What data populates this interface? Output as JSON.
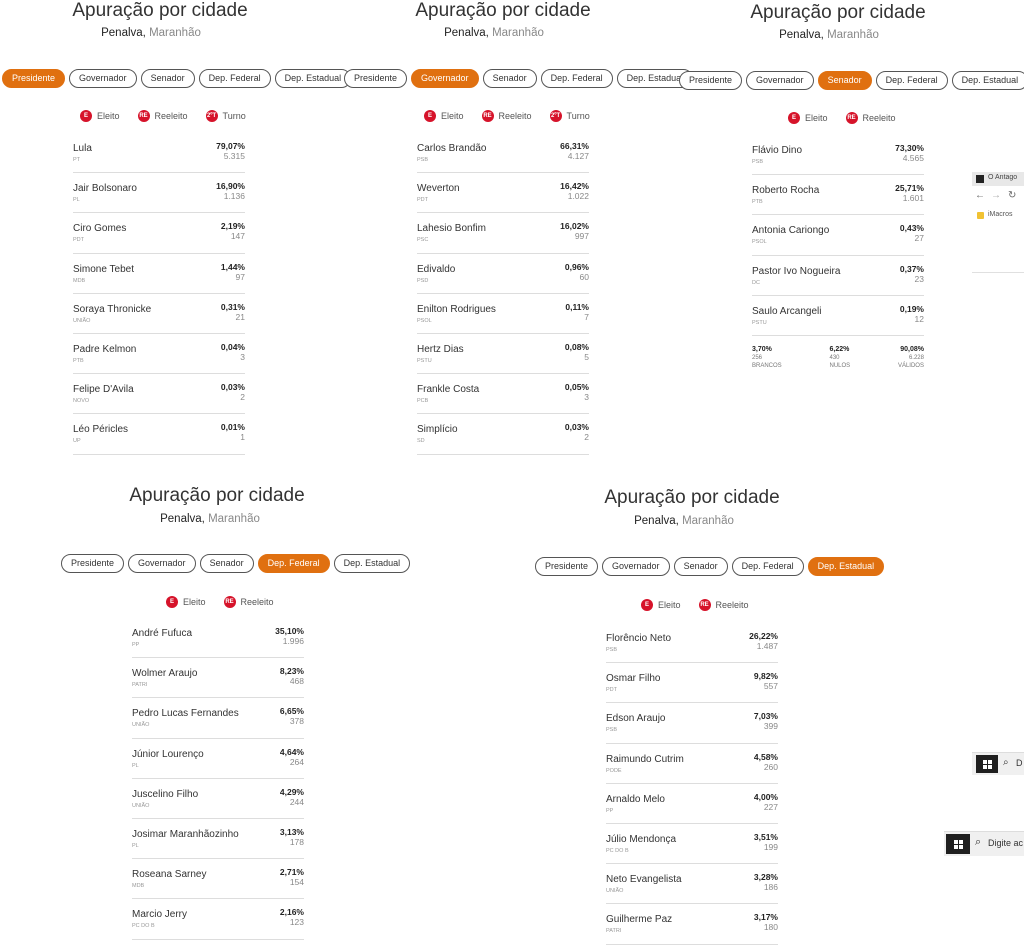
{
  "header": {
    "title": "Apuração por cidade",
    "city": "Penalva,",
    "state": "Maranhão"
  },
  "tabs": [
    "Presidente",
    "Governador",
    "Senador",
    "Dep. Federal",
    "Dep. Estadual"
  ],
  "legend": {
    "elected_badge": "E",
    "elected_label": "Eleito",
    "reelected_badge": "RE",
    "reelected_label": "Reeleito",
    "runoff_badge": "2ºT",
    "runoff_label": "Turno"
  },
  "panels": {
    "presidente": [
      {
        "name": "Lula",
        "party": "PT",
        "pct": "79,07%",
        "votes": "5.315"
      },
      {
        "name": "Jair Bolsonaro",
        "party": "PL",
        "pct": "16,90%",
        "votes": "1.136"
      },
      {
        "name": "Ciro Gomes",
        "party": "PDT",
        "pct": "2,19%",
        "votes": "147"
      },
      {
        "name": "Simone Tebet",
        "party": "MDB",
        "pct": "1,44%",
        "votes": "97"
      },
      {
        "name": "Soraya Thronicke",
        "party": "UNIÃO",
        "pct": "0,31%",
        "votes": "21"
      },
      {
        "name": "Padre Kelmon",
        "party": "PTB",
        "pct": "0,04%",
        "votes": "3"
      },
      {
        "name": "Felipe D'Avila",
        "party": "NOVO",
        "pct": "0,03%",
        "votes": "2"
      },
      {
        "name": "Léo Péricles",
        "party": "UP",
        "pct": "0,01%",
        "votes": "1"
      }
    ],
    "governador": [
      {
        "name": "Carlos Brandão",
        "party": "PSB",
        "pct": "66,31%",
        "votes": "4.127"
      },
      {
        "name": "Weverton",
        "party": "PDT",
        "pct": "16,42%",
        "votes": "1.022"
      },
      {
        "name": "Lahesio Bonfim",
        "party": "PSC",
        "pct": "16,02%",
        "votes": "997"
      },
      {
        "name": "Edivaldo",
        "party": "PSD",
        "pct": "0,96%",
        "votes": "60"
      },
      {
        "name": "Enilton Rodrigues",
        "party": "PSOL",
        "pct": "0,11%",
        "votes": "7"
      },
      {
        "name": "Hertz Dias",
        "party": "PSTU",
        "pct": "0,08%",
        "votes": "5"
      },
      {
        "name": "Frankle Costa",
        "party": "PCB",
        "pct": "0,05%",
        "votes": "3"
      },
      {
        "name": "Simplício",
        "party": "SD",
        "pct": "0,03%",
        "votes": "2"
      }
    ],
    "senador": [
      {
        "name": "Flávio Dino",
        "party": "PSB",
        "pct": "73,30%",
        "votes": "4.565"
      },
      {
        "name": "Roberto Rocha",
        "party": "PTB",
        "pct": "25,71%",
        "votes": "1.601"
      },
      {
        "name": "Antonia Cariongo",
        "party": "PSOL",
        "pct": "0,43%",
        "votes": "27"
      },
      {
        "name": "Pastor Ivo Nogueira",
        "party": "DC",
        "pct": "0,37%",
        "votes": "23"
      },
      {
        "name": "Saulo Arcangeli",
        "party": "PSTU",
        "pct": "0,19%",
        "votes": "12"
      }
    ],
    "senador_totals": [
      {
        "pct": "3,70%",
        "count": "256",
        "label": "BRANCOS"
      },
      {
        "pct": "6,22%",
        "count": "430",
        "label": "NULOS"
      },
      {
        "pct": "90,08%",
        "count": "6.228",
        "label": "VÁLIDOS"
      }
    ],
    "dep_federal": [
      {
        "name": "André Fufuca",
        "party": "PP",
        "pct": "35,10%",
        "votes": "1.996"
      },
      {
        "name": "Wolmer Araujo",
        "party": "PATRI",
        "pct": "8,23%",
        "votes": "468"
      },
      {
        "name": "Pedro Lucas Fernandes",
        "party": "UNIÃO",
        "pct": "6,65%",
        "votes": "378"
      },
      {
        "name": "Júnior Lourenço",
        "party": "PL",
        "pct": "4,64%",
        "votes": "264"
      },
      {
        "name": "Juscelino Filho",
        "party": "UNIÃO",
        "pct": "4,29%",
        "votes": "244"
      },
      {
        "name": "Josimar Maranhãozinho",
        "party": "PL",
        "pct": "3,13%",
        "votes": "178"
      },
      {
        "name": "Roseana Sarney",
        "party": "MDB",
        "pct": "2,71%",
        "votes": "154"
      },
      {
        "name": "Marcio Jerry",
        "party": "PC DO B",
        "pct": "2,16%",
        "votes": "123"
      }
    ],
    "dep_estadual": [
      {
        "name": "Florêncio Neto",
        "party": "PSB",
        "pct": "26,22%",
        "votes": "1.487"
      },
      {
        "name": "Osmar Filho",
        "party": "PDT",
        "pct": "9,82%",
        "votes": "557"
      },
      {
        "name": "Edson Araujo",
        "party": "PSB",
        "pct": "7,03%",
        "votes": "399"
      },
      {
        "name": "Raimundo Cutrim",
        "party": "PODE",
        "pct": "4,58%",
        "votes": "260"
      },
      {
        "name": "Arnaldo Melo",
        "party": "PP",
        "pct": "4,00%",
        "votes": "227"
      },
      {
        "name": "Júlio Mendonça",
        "party": "PC DO B",
        "pct": "3,51%",
        "votes": "199"
      },
      {
        "name": "Neto Evangelista",
        "party": "UNIÃO",
        "pct": "3,28%",
        "votes": "186"
      },
      {
        "name": "Guilherme Paz",
        "party": "PATRI",
        "pct": "3,17%",
        "votes": "180"
      }
    ]
  },
  "fragments": {
    "browser_tab": "O Antago",
    "bookmark": "iMacros",
    "taskbar_search_short": "D",
    "taskbar_search": "Digite ac"
  },
  "colors": {
    "accent": "#e07010",
    "badge": "#d6132a"
  }
}
